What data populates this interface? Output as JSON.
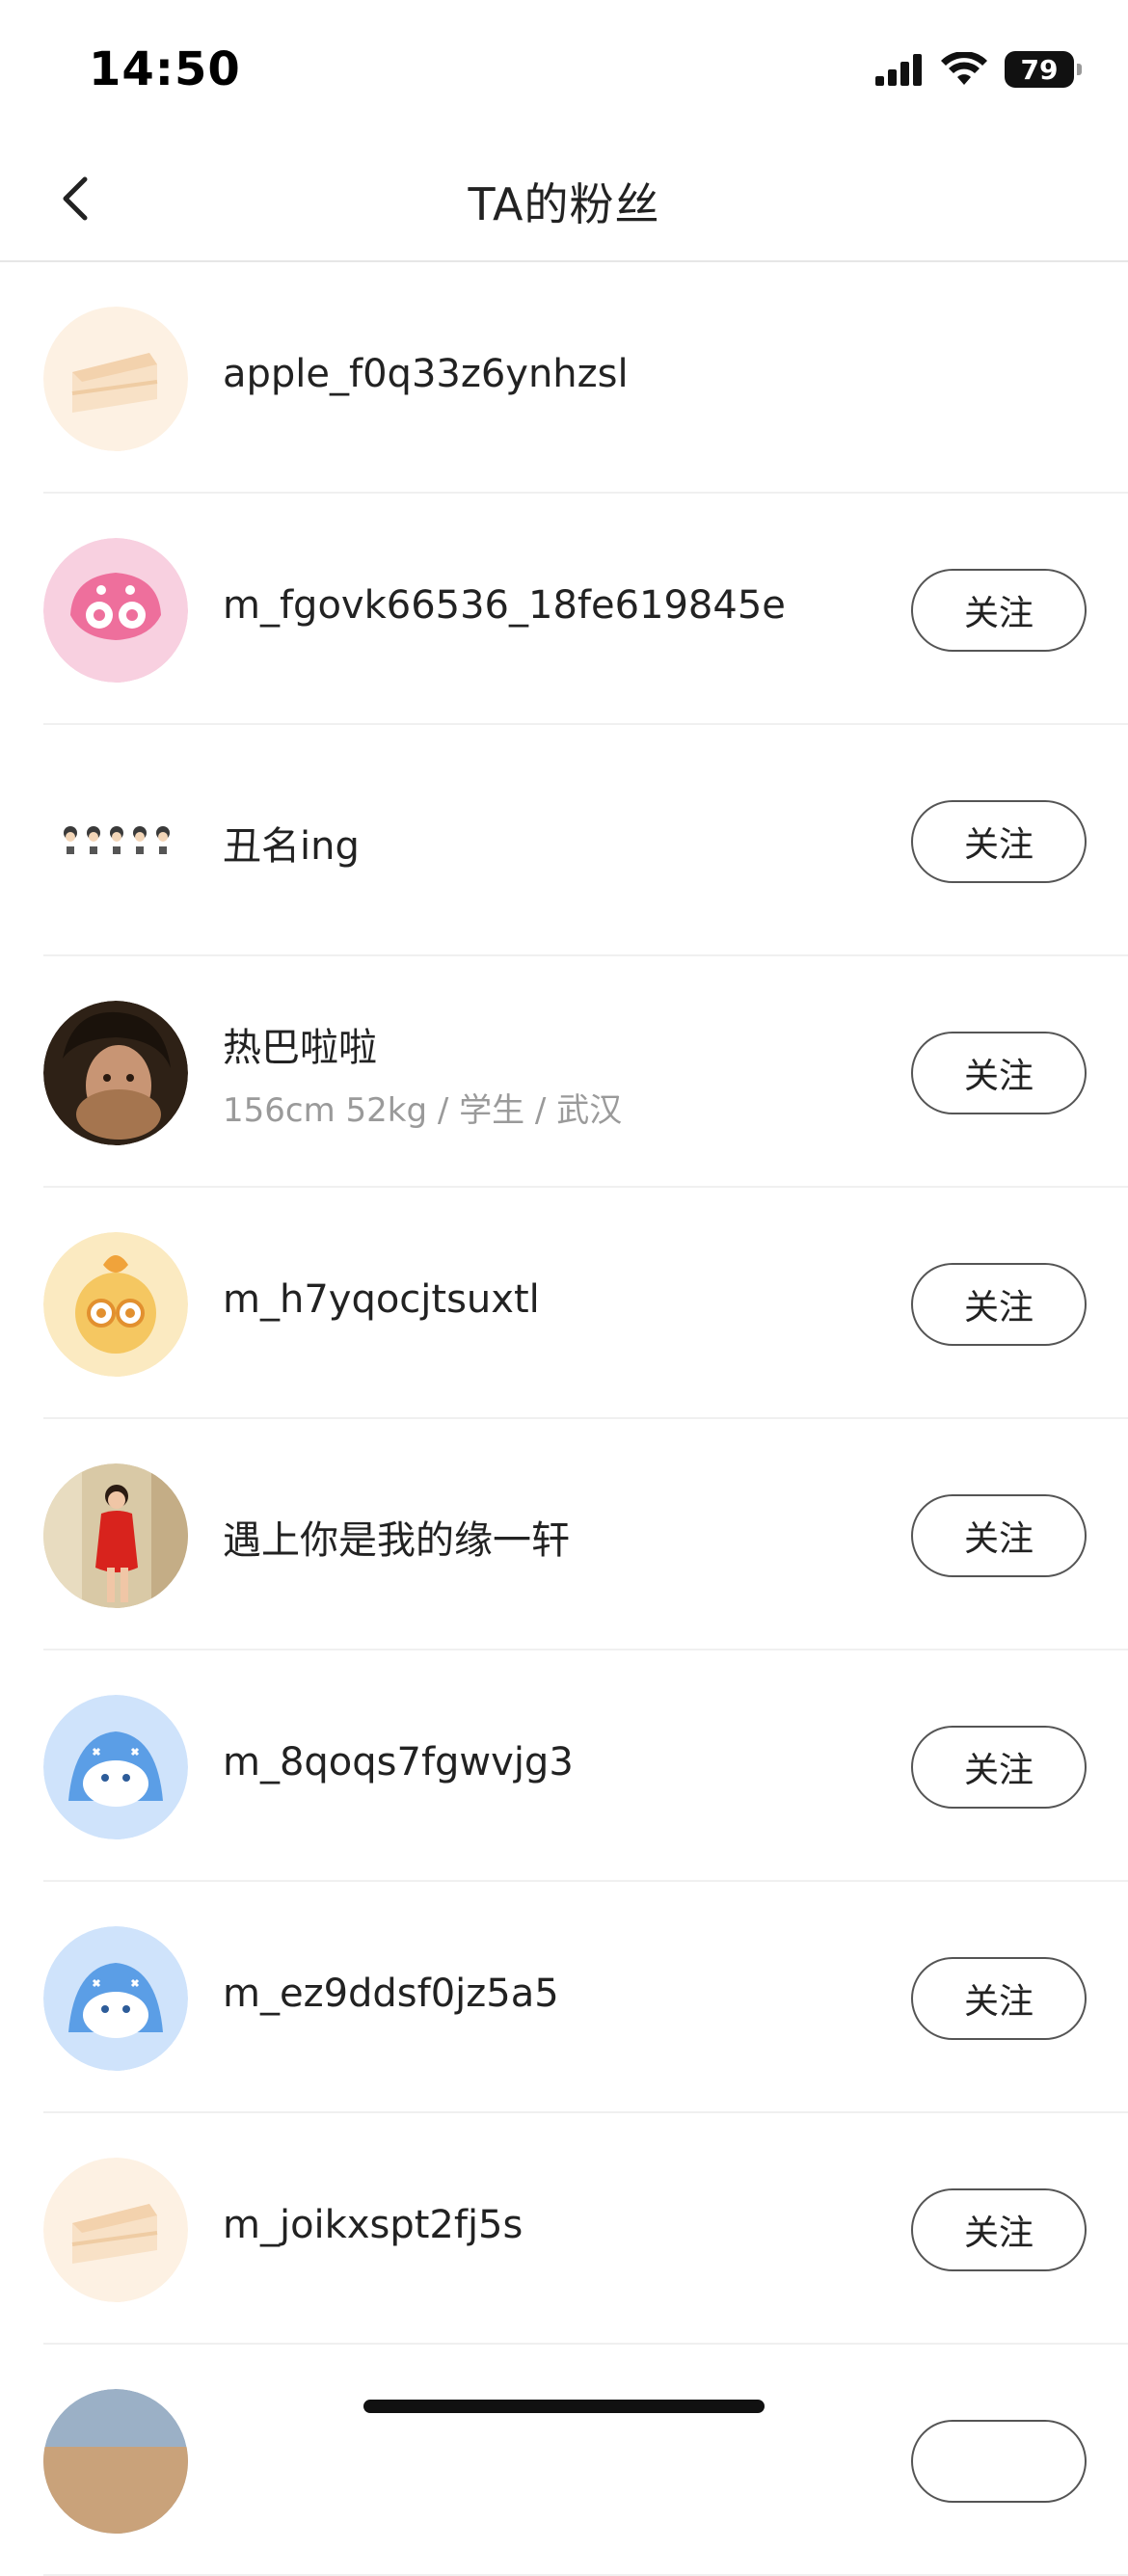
{
  "status": {
    "time": "14:50",
    "battery": "79"
  },
  "header": {
    "title": "TA的粉丝"
  },
  "follow_label": "关注",
  "users": [
    {
      "name": "apple_f0q33z6ynhzsl",
      "subtitle": "",
      "has_follow": false,
      "avatar": "cake-avatar"
    },
    {
      "name": "m_fgovk66536_18fe619845e",
      "subtitle": "",
      "has_follow": true,
      "avatar": "pink-mascot-avatar"
    },
    {
      "name": "丑名ing",
      "subtitle": "",
      "has_follow": true,
      "avatar": "emoji-row-avatar"
    },
    {
      "name": "热巴啦啦",
      "subtitle": "156cm 52kg / 学生 / 武汉",
      "has_follow": true,
      "avatar": "photo-avatar"
    },
    {
      "name": "m_h7yqocjtsuxtl",
      "subtitle": "",
      "has_follow": true,
      "avatar": "yellow-mascot-avatar"
    },
    {
      "name": "遇上你是我的缘一轩",
      "subtitle": "",
      "has_follow": true,
      "avatar": "red-dress-photo-avatar"
    },
    {
      "name": "m_8qoqs7fgwvjg3",
      "subtitle": "",
      "has_follow": true,
      "avatar": "blue-mascot-avatar"
    },
    {
      "name": "m_ez9ddsf0jz5a5",
      "subtitle": "",
      "has_follow": true,
      "avatar": "blue-mascot-avatar"
    },
    {
      "name": "m_joikxspt2fj5s",
      "subtitle": "",
      "has_follow": true,
      "avatar": "cake-avatar"
    }
  ],
  "colors": {
    "divider": "#f0f0f0",
    "subtitle": "#9a9a9a",
    "button_border": "#555555"
  }
}
